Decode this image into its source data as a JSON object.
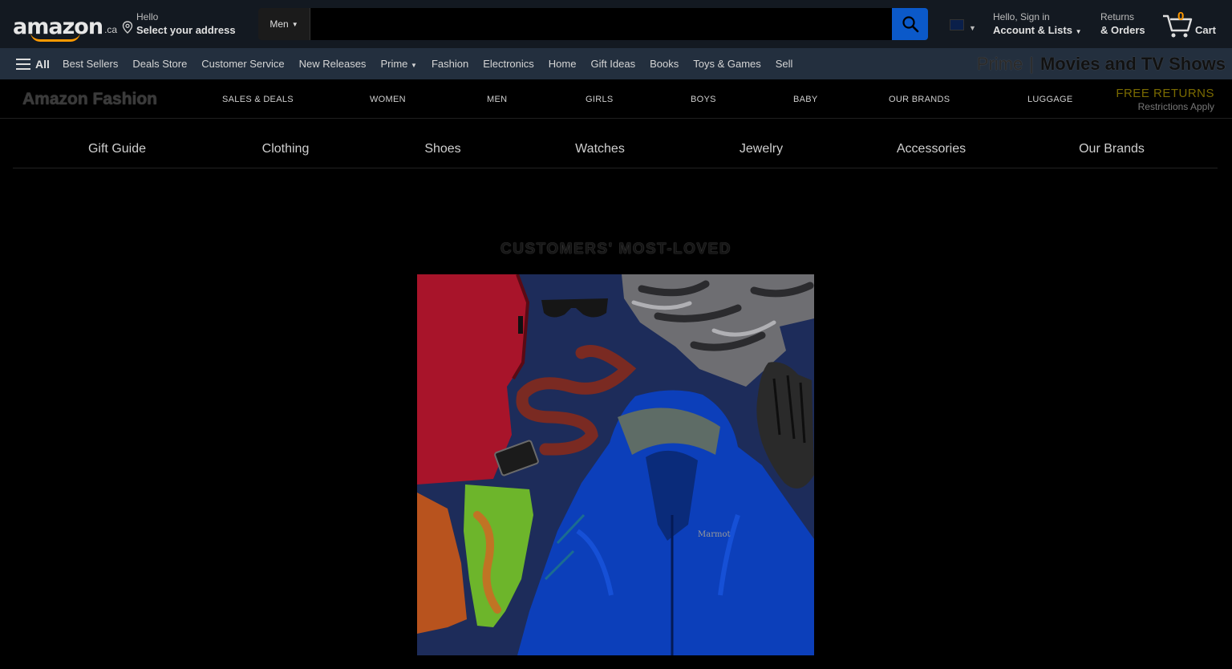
{
  "header": {
    "logo_text": "amazon",
    "logo_suffix": ".ca",
    "deliver_line1": "Hello",
    "deliver_line2": "Select your address",
    "search_category": "Men",
    "search_value": "",
    "search_placeholder": "",
    "account_line1": "Hello, Sign in",
    "account_line2": "Account & Lists",
    "returns_line1": "Returns",
    "returns_line2": "& Orders",
    "cart_count": "0",
    "cart_label": "Cart"
  },
  "nav": {
    "all_label": "All",
    "links": [
      "Best Sellers",
      "Deals Store",
      "Customer Service",
      "New Releases",
      "Prime",
      "Fashion",
      "Electronics",
      "Home",
      "Gift Ideas",
      "Books",
      "Toys & Games",
      "Sell"
    ],
    "prime_ad_part1": "Prime",
    "prime_ad_sep": "|",
    "prime_ad_part2": "Movies and TV Shows"
  },
  "fashion": {
    "title": "Amazon Fashion",
    "links": [
      "SALES & DEALS",
      "WOMEN",
      "MEN",
      "GIRLS",
      "BOYS",
      "BABY",
      "OUR BRANDS",
      "LUGGAGE"
    ],
    "free_returns": "FREE RETURNS",
    "restrictions": "Restrictions Apply"
  },
  "categories": [
    "Gift Guide",
    "Clothing",
    "Shoes",
    "Watches",
    "Jewelry",
    "Accessories",
    "Our Brands"
  ],
  "headline": "CUSTOMERS' MOST-LOVED",
  "hero": {
    "jacket_brand": "Marmot"
  },
  "colors": {
    "header_bg": "#131921",
    "nav_bg": "#232f3e",
    "search_button": "#0b59c9",
    "accent": "#ff9900"
  }
}
